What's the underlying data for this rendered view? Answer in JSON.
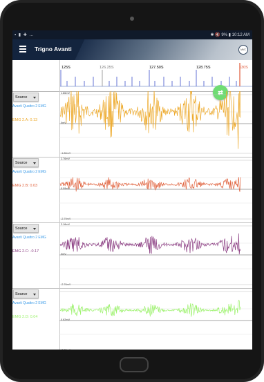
{
  "statusbar": {
    "left_icons": "▪ ▮ ✚ …",
    "right_text": "✱ 🔇 9% ▮ 10:12 AM"
  },
  "appbar": {
    "title": "Trigno Avanti",
    "avatar_text": "MVC"
  },
  "timeline": {
    "ticks": [
      "125S",
      "126.25S",
      "127.50S",
      "128.75S",
      "130S"
    ]
  },
  "channels": [
    {
      "source_label": "Source",
      "sensor": "Avanti Quattro 2 EMG",
      "emg_label": "EMG 2.A: 0.13",
      "color": "#eda92a",
      "ymax": "1.86mV",
      "ymid": "0mV",
      "ymin": "-1.86mV"
    },
    {
      "source_label": "Source",
      "sensor": "Avanti Quattro 2 EMG",
      "emg_label": "EMG 2.B: 0.03",
      "color": "#e0623d",
      "ymax": "2.76mV",
      "ymid": "0.09mV",
      "ymin": "-2.79mV"
    },
    {
      "source_label": "Source",
      "sensor": "Avanti Quattro 2 EMG",
      "emg_label": "EMG 2.C: -0.17",
      "color": "#8b3d82",
      "ymax": "2.16mV",
      "ymid": "0mV",
      "ymin": "-2.76mV"
    },
    {
      "source_label": "Source",
      "sensor": "Avanti Quattro 2 EMG",
      "emg_label": "EMG 2.D: 0.04",
      "color": "#9cf26c",
      "ymax": "",
      "ymid": "0.62mV",
      "ymin": "-2.76mV"
    }
  ]
}
